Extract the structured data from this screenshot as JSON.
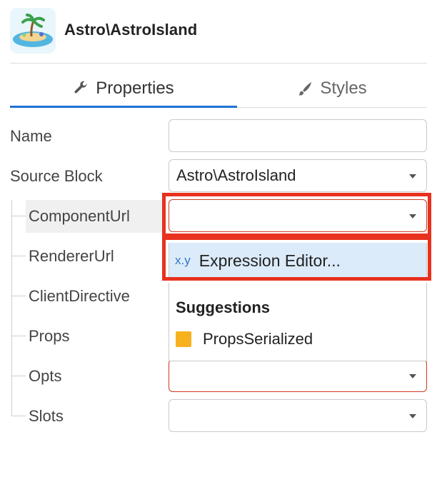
{
  "header": {
    "title": "Astro\\AstroIsland",
    "logo_icon": "island-icon"
  },
  "tabs": [
    {
      "label": "Properties",
      "icon": "wrench-icon",
      "active": true
    },
    {
      "label": "Styles",
      "icon": "brush-icon",
      "active": false
    }
  ],
  "fields": {
    "name": {
      "label": "Name",
      "value": ""
    },
    "source_block": {
      "label": "Source Block",
      "value": "Astro\\AstroIsland"
    },
    "component_url": {
      "label": "ComponentUrl",
      "value": ""
    },
    "renderer_url": {
      "label": "RendererUrl"
    },
    "client_directive": {
      "label": "ClientDirective"
    },
    "props": {
      "label": "Props"
    },
    "opts": {
      "label": "Opts",
      "value": ""
    },
    "slots": {
      "label": "Slots",
      "value": ""
    }
  },
  "dropdown": {
    "expression_item": {
      "prefix": "x.y",
      "label": "Expression Editor..."
    },
    "suggestions_heading": "Suggestions",
    "suggestions": [
      {
        "label": "PropsSerialized",
        "color": "#f7b11f"
      }
    ]
  },
  "colors": {
    "accent": "#1e73d6",
    "highlight": "#e8311f",
    "selected_bg": "#dcebfa"
  }
}
